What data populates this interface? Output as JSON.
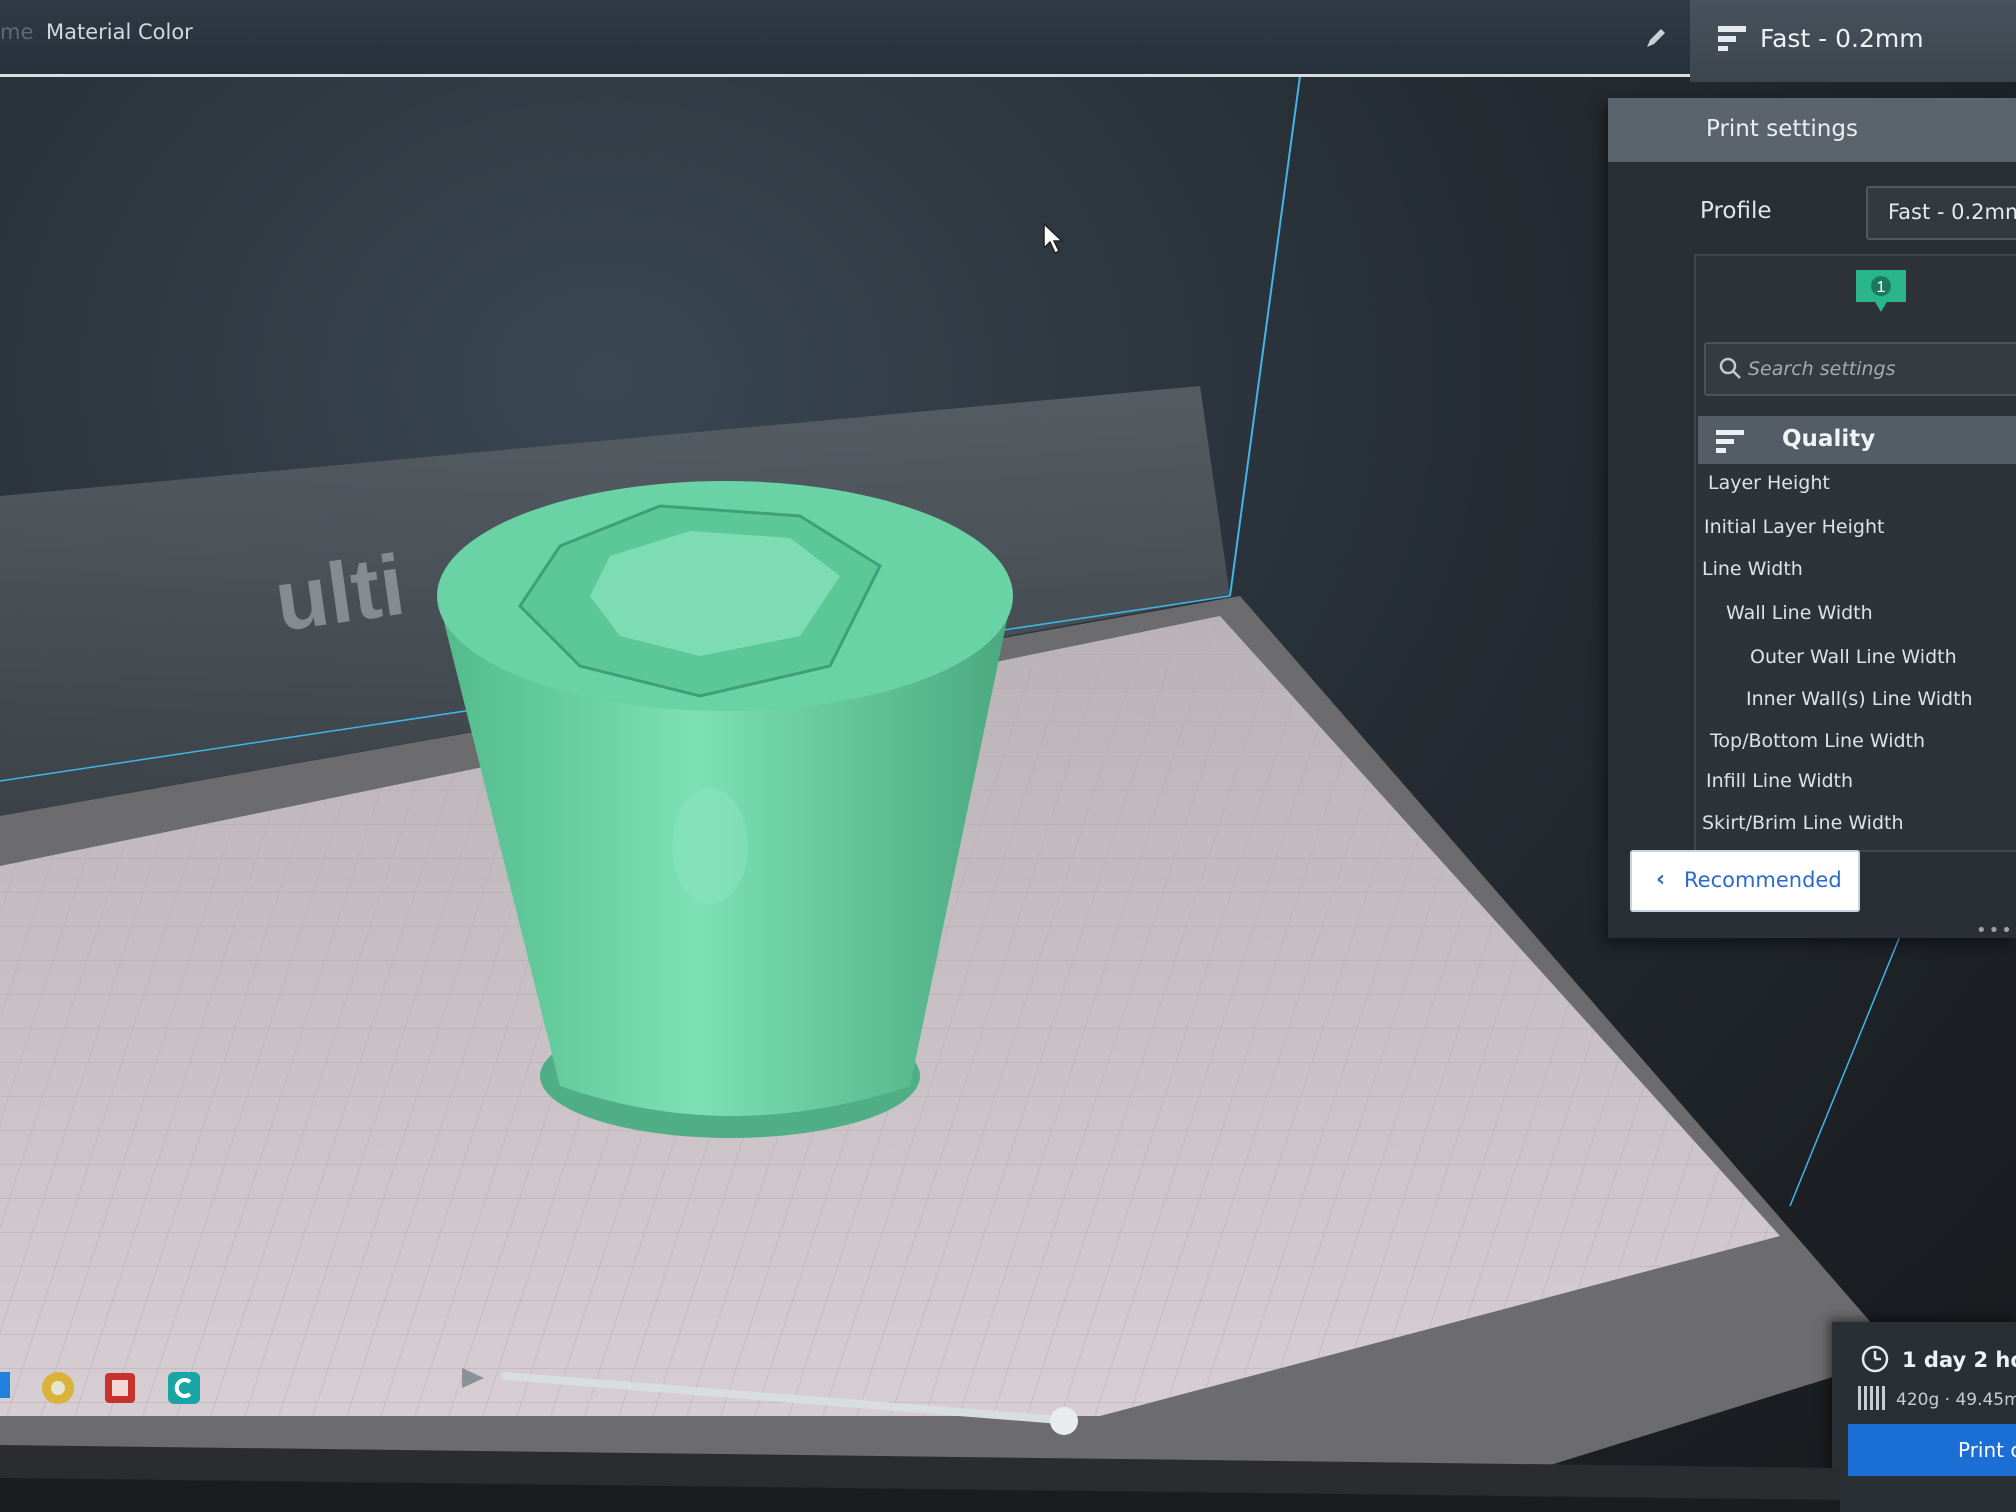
{
  "topbar": {
    "prev_crumb": "me",
    "crumb": "Material Color",
    "edit_icon": "pencil-icon"
  },
  "profile_chip": {
    "label": "Fast - 0.2mm",
    "icon": "settings-lines-icon"
  },
  "viewport": {
    "build_plate_logo": "ulti",
    "model_color": "#5ec99a",
    "plate_color": "#c9c0c4",
    "bounding_line_color": "#3fb6e8"
  },
  "print_settings": {
    "title": "Print settings",
    "profile_label": "Profile",
    "profile_value": "Fast - 0.2mm",
    "badge_count": "1",
    "search_placeholder": "Search settings",
    "category": "Quality",
    "settings": [
      "Layer Height",
      "Initial Layer Height",
      "Line Width",
      "Wall Line Width",
      "Outer Wall Line Width",
      "Inner Wall(s) Line Width",
      "Top/Bottom Line Width",
      "Infill Line Width",
      "Skirt/Brim Line Width"
    ],
    "recommended_button": "Recommended"
  },
  "estimate": {
    "time": "1 day 2 hou",
    "material": "420g · 49.45m",
    "print_button": "Print c"
  },
  "taskbar": {
    "icons": [
      "windows-icon",
      "chrome-icon",
      "app-red-icon",
      "cura-icon"
    ]
  },
  "colors": {
    "accent_blue": "#1b6ed4",
    "badge_green": "#2bb58a",
    "panel_bg": "#2a2f35"
  }
}
